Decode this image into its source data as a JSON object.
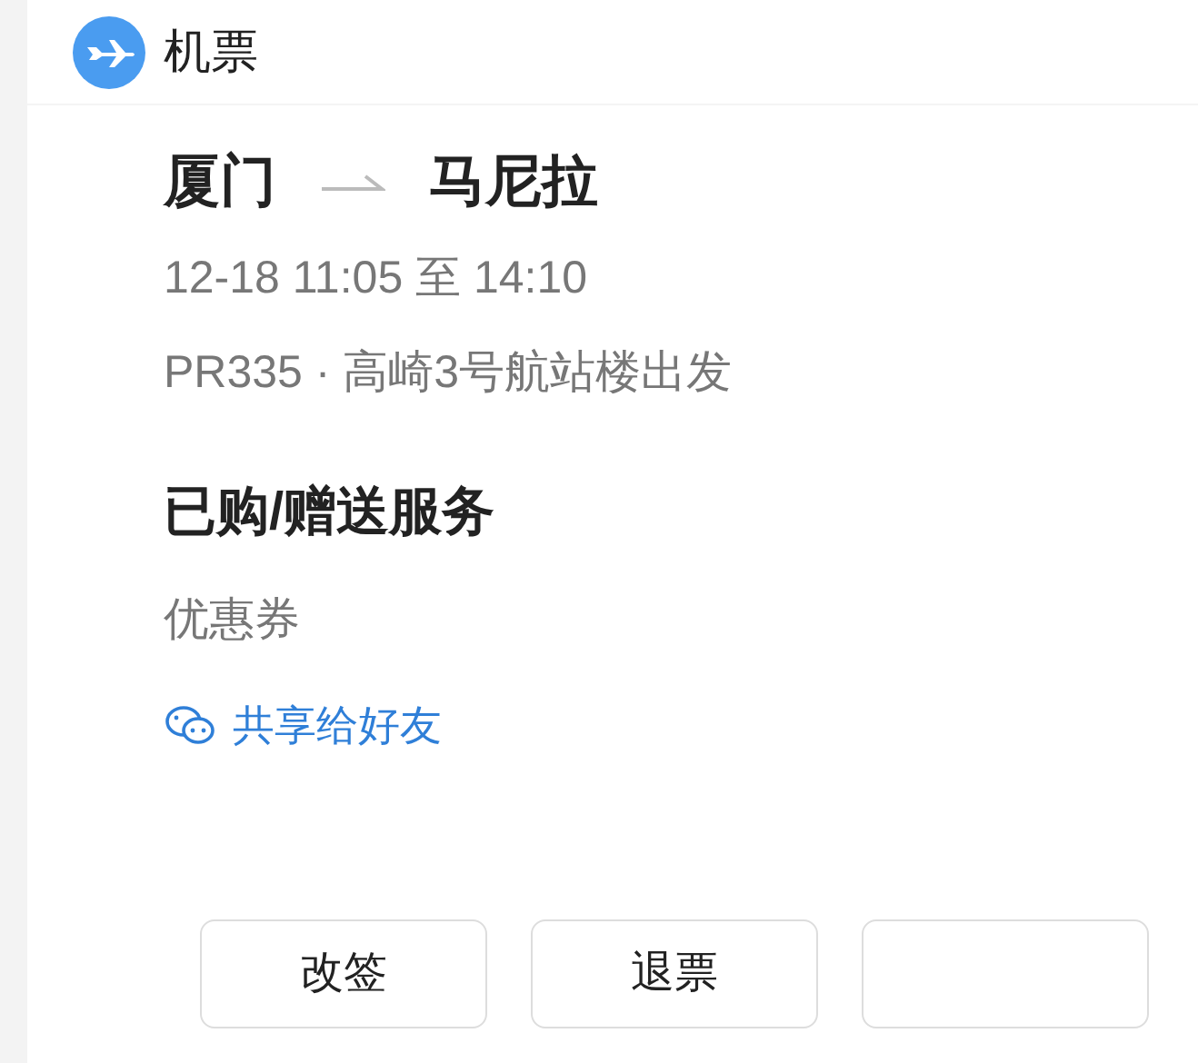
{
  "header": {
    "title": "机票"
  },
  "flight": {
    "from": "厦门",
    "to": "马尼拉",
    "time": "12-18 11:05 至 14:10",
    "detail": "PR335 · 高崎3号航站楼出发"
  },
  "services": {
    "title": "已购/赠送服务",
    "items": [
      "优惠券"
    ]
  },
  "share": {
    "label": "共享给好友"
  },
  "buttons": [
    {
      "label": "改签"
    },
    {
      "label": "退票"
    }
  ],
  "partial_button": {
    "kind": "blank"
  }
}
